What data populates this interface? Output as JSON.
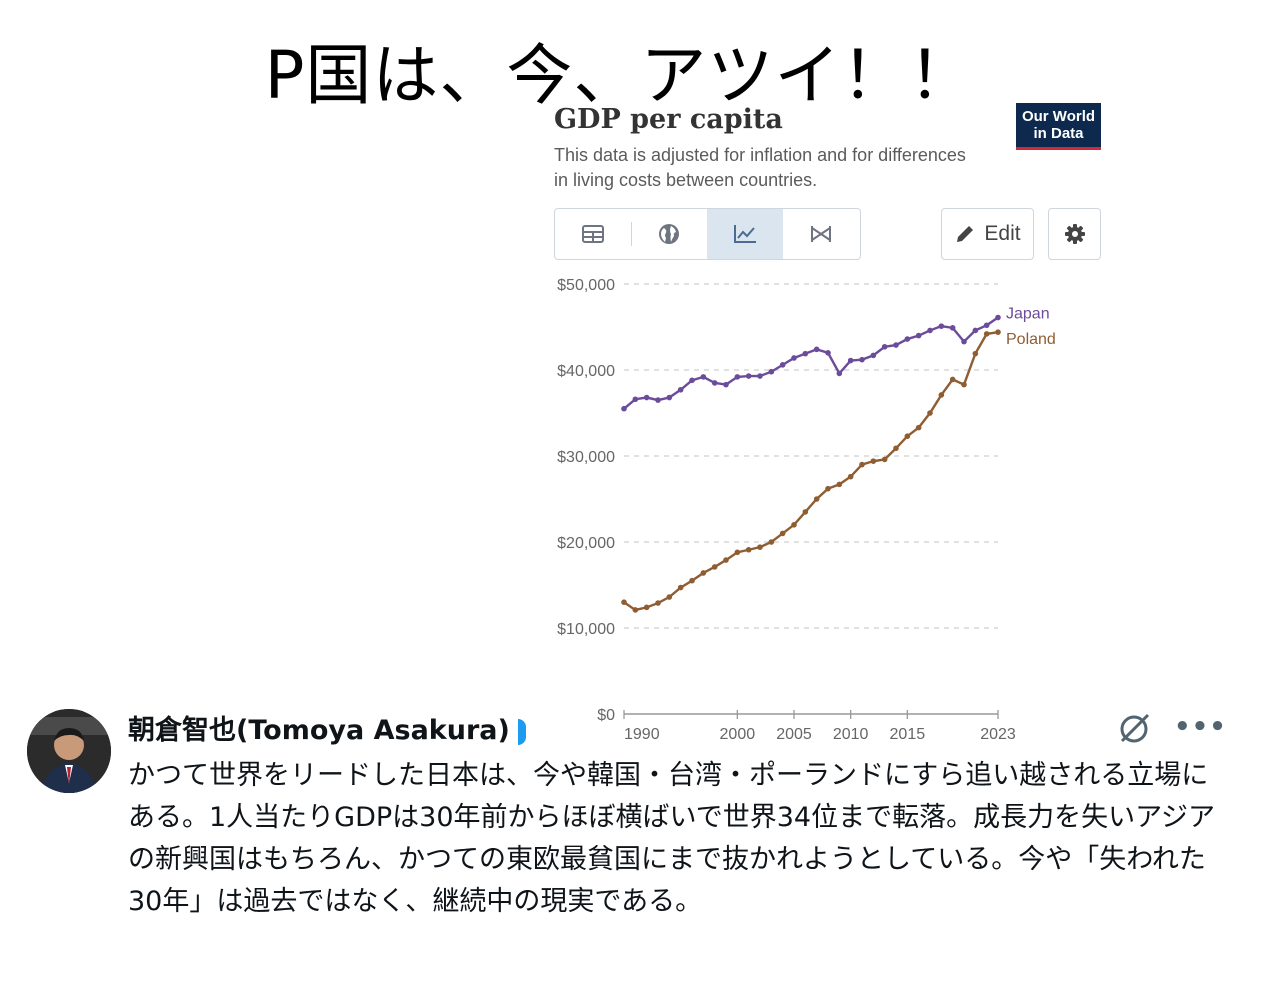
{
  "headline": "P国は、今、アツイ！！",
  "card": {
    "title": "GDP per capita",
    "subtitle": "This data is adjusted for inflation and for differences in living costs between countries.",
    "logo_line1": "Our World",
    "logo_line2": "in Data",
    "tabs": [
      {
        "icon": "table-icon",
        "active": false
      },
      {
        "icon": "globe-icon",
        "active": false
      },
      {
        "icon": "line-chart-icon",
        "active": true
      },
      {
        "icon": "slope-chart-icon",
        "active": false
      }
    ],
    "edit_label": "Edit",
    "settings_icon": "gear-icon"
  },
  "chart_data": {
    "type": "line",
    "title": "GDP per capita",
    "ylim": [
      0,
      50000
    ],
    "y_ticks": [
      "$0",
      "$10,000",
      "$20,000",
      "$30,000",
      "$40,000",
      "$50,000"
    ],
    "x_ticks": [
      "1990",
      "2000",
      "2005",
      "2010",
      "2015",
      "2023"
    ],
    "xlim": [
      1990,
      2023
    ],
    "grid": true,
    "series": [
      {
        "name": "Japan",
        "color": "#6b4c9a",
        "x": [
          1990,
          1991,
          1992,
          1993,
          1994,
          1995,
          1996,
          1997,
          1998,
          1999,
          2000,
          2001,
          2002,
          2003,
          2004,
          2005,
          2006,
          2007,
          2008,
          2009,
          2010,
          2011,
          2012,
          2013,
          2014,
          2015,
          2016,
          2017,
          2018,
          2019,
          2020,
          2021,
          2022,
          2023
        ],
        "values": [
          35500,
          36600,
          36800,
          36500,
          36800,
          37700,
          38800,
          39200,
          38500,
          38300,
          39200,
          39300,
          39300,
          39800,
          40600,
          41400,
          41900,
          42400,
          42000,
          39600,
          41100,
          41200,
          41700,
          42700,
          42900,
          43600,
          44000,
          44600,
          45100,
          44900,
          43300,
          44600,
          45200,
          46100
        ]
      },
      {
        "name": "Poland",
        "color": "#8f5d32",
        "x": [
          1990,
          1991,
          1992,
          1993,
          1994,
          1995,
          1996,
          1997,
          1998,
          1999,
          2000,
          2001,
          2002,
          2003,
          2004,
          2005,
          2006,
          2007,
          2008,
          2009,
          2010,
          2011,
          2012,
          2013,
          2014,
          2015,
          2016,
          2017,
          2018,
          2019,
          2020,
          2021,
          2022,
          2023
        ],
        "values": [
          13000,
          12100,
          12400,
          12900,
          13600,
          14700,
          15500,
          16400,
          17100,
          17900,
          18800,
          19100,
          19400,
          20000,
          21000,
          22000,
          23500,
          25000,
          26200,
          26700,
          27600,
          29000,
          29400,
          29600,
          30900,
          32300,
          33300,
          35000,
          37100,
          38900,
          38300,
          41900,
          44200,
          44400
        ]
      }
    ]
  },
  "tweet": {
    "author": "朝倉智也(Tomoya Asakura)",
    "text": "かつて世界をリードした日本は、今や韓国・台湾・ポーランドにすら追い越される立場にある。1人当たりGDPは30年前からほぼ横ばいで世界34位まで転落。成長力を失いアジアの新興国はもちろん、かつての東欧最貧国にまで抜かれようとしている。今や「失われた30年」は過去ではなく、継続中の現実である。",
    "more_label": "•••"
  }
}
